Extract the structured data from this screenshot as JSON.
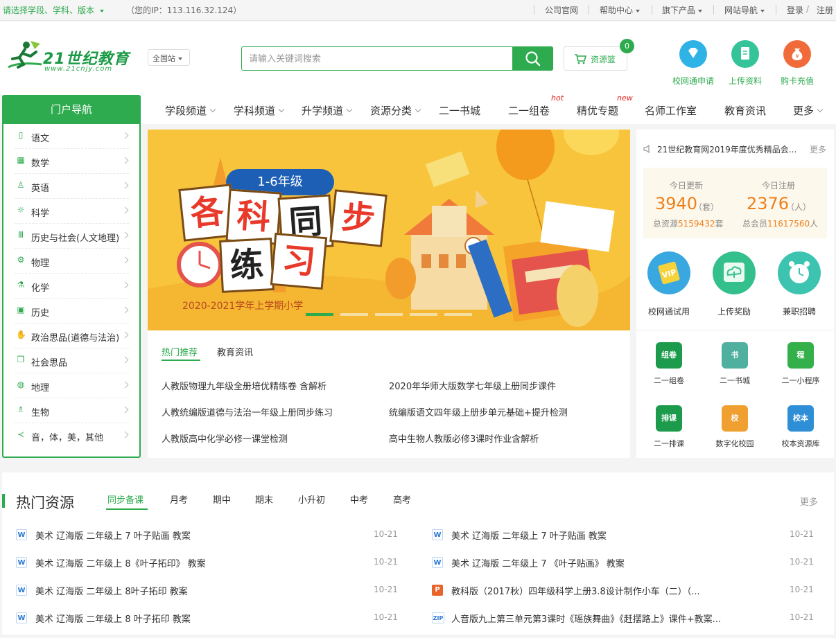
{
  "topbar": {
    "select_text": "请选择学段、学科、版本",
    "ip_text": "（您的IP：113.116.32.124）",
    "links": [
      "公司官网",
      "帮助中心",
      "旗下产品",
      "网站导航"
    ],
    "login": "登录",
    "slash": "/",
    "register": "注册"
  },
  "header": {
    "logo_text": "21世纪教育",
    "logo_sub": "www.21cnjy.com",
    "site_select": "全国站",
    "search_placeholder": "请输入关键词搜索",
    "basket_label": "资源篮",
    "basket_count": "0",
    "quick_links": [
      {
        "label": "校网通申请",
        "icon": "diamond-icon",
        "color": "#2fb3e6"
      },
      {
        "label": "上传资料",
        "icon": "document-icon",
        "color": "#35c39a"
      },
      {
        "label": "购卡充值",
        "icon": "money-bag-icon",
        "color": "#f06a3a"
      }
    ]
  },
  "portal": {
    "title": "门户导航",
    "items": [
      {
        "label": "语文",
        "icon": "book-icon"
      },
      {
        "label": "数学",
        "icon": "calculator-icon"
      },
      {
        "label": "英语",
        "icon": "abc-icon"
      },
      {
        "label": "科学",
        "icon": "atom-icon"
      },
      {
        "label": "历史与社会(人文地理)",
        "icon": "pillars-icon"
      },
      {
        "label": "物理",
        "icon": "gear-icon"
      },
      {
        "label": "化学",
        "icon": "flask-icon"
      },
      {
        "label": "历史",
        "icon": "calendar-icon"
      },
      {
        "label": "政治思品(道德与法治)",
        "icon": "hand-icon"
      },
      {
        "label": "社会思品",
        "icon": "layers-icon"
      },
      {
        "label": "地理",
        "icon": "globe-icon"
      },
      {
        "label": "生物",
        "icon": "microscope-icon"
      },
      {
        "label": "音，体，美，其他",
        "icon": "share-icon"
      }
    ]
  },
  "mainnav": {
    "items": [
      "学段频道",
      "学科频道",
      "升学频道",
      "资源分类",
      "二一书城",
      "二一组卷",
      "精优专题",
      "名师工作室",
      "教育资讯",
      "更多"
    ],
    "hot_tag": "hot",
    "new_tag": "new"
  },
  "banner": {
    "grade": "1-6年级",
    "chars": [
      "各",
      "科",
      "同",
      "步",
      "练",
      "习"
    ],
    "term": "2020-2021学年上学期小学",
    "slide_count": 5,
    "active_slide": 1
  },
  "news": {
    "tabs": [
      "热门推荐",
      "教育资讯"
    ],
    "left": [
      "人教版物理九年级全册培优精练卷 含解析",
      "人教统编版道德与法治一年级上册同步练习",
      "人教版高中化学必修一课堂检测"
    ],
    "right": [
      "2020年华师大版数学七年级上册同步课件",
      "统编版语文四年级上册步单元基础+提升检测",
      "高中生物人教版必修3课时作业含解析"
    ]
  },
  "right": {
    "notice": "21世纪教育网2019年度优秀精品会...",
    "more": "更多",
    "today_update_label": "今日更新",
    "today_update_value": "3940",
    "today_update_unit": "（套）",
    "total_res_label": "总资源",
    "total_res_value": "5159432",
    "total_res_unit": "套",
    "today_reg_label": "今日注册",
    "today_reg_value": "2376",
    "today_reg_unit": "（人）",
    "total_mem_label": "总会员",
    "total_mem_value": "11617560",
    "total_mem_unit": "人",
    "round_links": [
      {
        "label": "校网通试用",
        "icon": "vip-icon",
        "color": "#3aa8e0"
      },
      {
        "label": "上传奖励",
        "icon": "cloud-upload-icon",
        "color": "#33c08c"
      },
      {
        "label": "兼职招聘",
        "icon": "alarm-clock-icon",
        "color": "#3cc4b0"
      }
    ],
    "square_links": [
      {
        "label": "二一组卷",
        "icon_text": "组卷",
        "color": "#1c9b4c"
      },
      {
        "label": "二一书城",
        "icon_text": "书",
        "color": "#4fb0a0"
      },
      {
        "label": "二一小程序",
        "icon_text": "程",
        "color": "#33b04a"
      },
      {
        "label": "二一排课",
        "icon_text": "排课",
        "color": "#1c9b4c"
      },
      {
        "label": "数字化校园",
        "icon_text": "校",
        "color": "#f0a030"
      },
      {
        "label": "校本资源库",
        "icon_text": "校本",
        "color": "#2e8fd6"
      }
    ]
  },
  "hot": {
    "title": "热门资源",
    "tabs": [
      "同步备课",
      "月考",
      "期中",
      "期末",
      "小升初",
      "中考",
      "高考"
    ],
    "more": "更多",
    "left": [
      {
        "type": "W",
        "title": "美术 辽海版 二年级上 7 叶子贴画 教案",
        "date": "10-21"
      },
      {
        "type": "W",
        "title": "美术 辽海版 二年级上 8《叶子拓印》 教案",
        "date": "10-21"
      },
      {
        "type": "W",
        "title": "美术 辽海版 二年级上 8叶子拓印 教案",
        "date": "10-21"
      },
      {
        "type": "W",
        "title": "美术 辽海版 二年级上 8 叶子拓印 教案",
        "date": "10-21"
      }
    ],
    "right": [
      {
        "type": "W",
        "title": "美术 辽海版 二年级上 7 叶子贴画 教案",
        "date": "10-21"
      },
      {
        "type": "W",
        "title": "美术 辽海版 二年级上 7 《叶子贴画》 教案",
        "date": "10-21"
      },
      {
        "type": "P",
        "title": "教科版（2017秋）四年级科学上册3.8设计制作小车（二）（...",
        "date": "10-21"
      },
      {
        "type": "ZIP",
        "title": "人音版九上第三单元第3课时《瑶族舞曲》《赶摆路上》课件+教案...",
        "date": "10-21"
      }
    ]
  }
}
